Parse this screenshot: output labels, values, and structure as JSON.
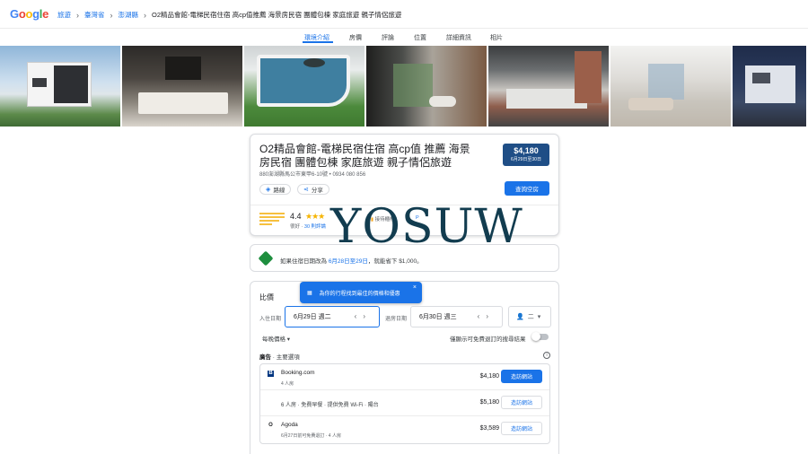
{
  "header": {
    "logo": "Google",
    "breadcrumbs": [
      "旅遊",
      "臺灣省",
      "澎湖縣",
      "O2精品會館-電梯民宿住宿 高cp值推薦 海景房民宿 團體包棟 家庭旅遊 親子情侶旅遊"
    ]
  },
  "tabs": [
    "環境介紹",
    "房價",
    "評論",
    "位置",
    "詳細資訊",
    "相片"
  ],
  "hotel": {
    "name": "O2精品會館-電梯民宿住宿 高cp值 推薦 海景房民宿 團體包棟 家庭旅遊 親子情侶旅遊",
    "address": "880澎湖縣馬公市東甲6-10號 • 0934 080 856",
    "route_label": "路線",
    "share_label": "分享",
    "price": "$4,180",
    "price_dates": "6月29日至30日",
    "check_rooms_label": "查詢空房",
    "rating": "4.4",
    "stars": "★★★",
    "rating_sub_prefix": "很好 · ",
    "rating_reviews": "30 則評論",
    "amenity_1": "接待櫃檯",
    "amenity_2": "P"
  },
  "watermark": "YOSUW",
  "deal": {
    "prefix": "如果住宿日期改為 ",
    "dates": "6月28日至29日",
    "suffix": "，就能省下 $1,000。"
  },
  "pricing": {
    "title": "比價",
    "tooltip": "為你的行程找到最佳的價格和優惠",
    "tooltip_close": "×",
    "checkin_label": "入住日期",
    "checkin": "6月29日 週二",
    "checkout_label": "退房日期",
    "checkout": "6月30日 週三",
    "guests": "二",
    "per_night": "每晚價格 ▾",
    "toggle_label": "僅顯示可免費退訂的搜尋結果",
    "ad_prefix": "廣告",
    "ad_label": " · 主要選項",
    "offers": [
      {
        "logo": "B",
        "name": "Booking.com",
        "sub": "4 人房",
        "price": "$4,180",
        "action": "造訪網站"
      },
      {
        "desc": "6 人房 · 免費早餐 · 提供免費 Wi-Fi · 陽台",
        "price": "$5,180",
        "action": "造訪網站"
      },
      {
        "logo": "O",
        "name": "Agoda",
        "sub": "6月27日前可免費退訂 · 4 人房",
        "price": "$3,589",
        "action": "造訪網站"
      }
    ]
  },
  "colors": {
    "accent": "#1a73e8",
    "price_badge": "#1f4e86",
    "deal_green": "#1e8e3e",
    "star": "#f6b400"
  }
}
